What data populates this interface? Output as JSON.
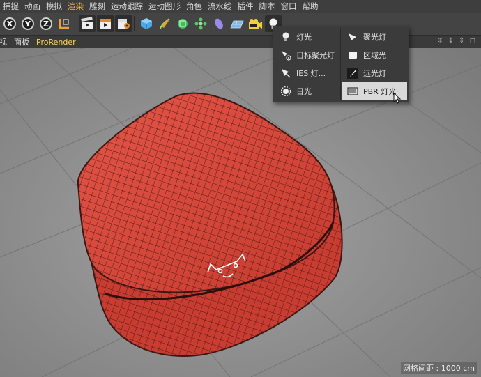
{
  "menubar": {
    "items": [
      {
        "label": "捕捉"
      },
      {
        "label": "动画"
      },
      {
        "label": "模拟"
      },
      {
        "label": "渲染",
        "accent": true
      },
      {
        "label": "雕刻"
      },
      {
        "label": "运动跟踪"
      },
      {
        "label": "运动图形"
      },
      {
        "label": "角色"
      },
      {
        "label": "流水线"
      },
      {
        "label": "插件"
      },
      {
        "label": "脚本"
      },
      {
        "label": "窗口"
      },
      {
        "label": "帮助"
      }
    ]
  },
  "toolbar": {
    "axes": [
      "X",
      "Y",
      "Z"
    ]
  },
  "viewbar": {
    "items": [
      "视",
      "面板",
      "ProRender"
    ],
    "right_icons": "⁜ ↕ ⇕ ◻"
  },
  "light_popup": {
    "left_items": [
      {
        "label": "灯光",
        "icon": "bulb-icon"
      },
      {
        "label": "目标聚光灯",
        "icon": "target-spotlight-icon"
      },
      {
        "label": "IES 灯...",
        "icon": "ies-light-icon"
      },
      {
        "label": "日光",
        "icon": "sun-icon"
      }
    ],
    "right_items": [
      {
        "label": "聚光灯",
        "icon": "spotlight-icon"
      },
      {
        "label": "区域光",
        "icon": "area-light-icon"
      },
      {
        "label": "远光灯",
        "icon": "infinite-light-icon"
      },
      {
        "label": "PBR 灯光",
        "icon": "pbr-light-icon",
        "selected": true
      }
    ]
  },
  "viewport": {
    "grid_spacing_label": "网格间距 : 1000 cm"
  },
  "colors": {
    "object_red": "#d8473b",
    "viewport_gray": "#8d8d8d",
    "accent_yellow": "#f2b64a"
  }
}
